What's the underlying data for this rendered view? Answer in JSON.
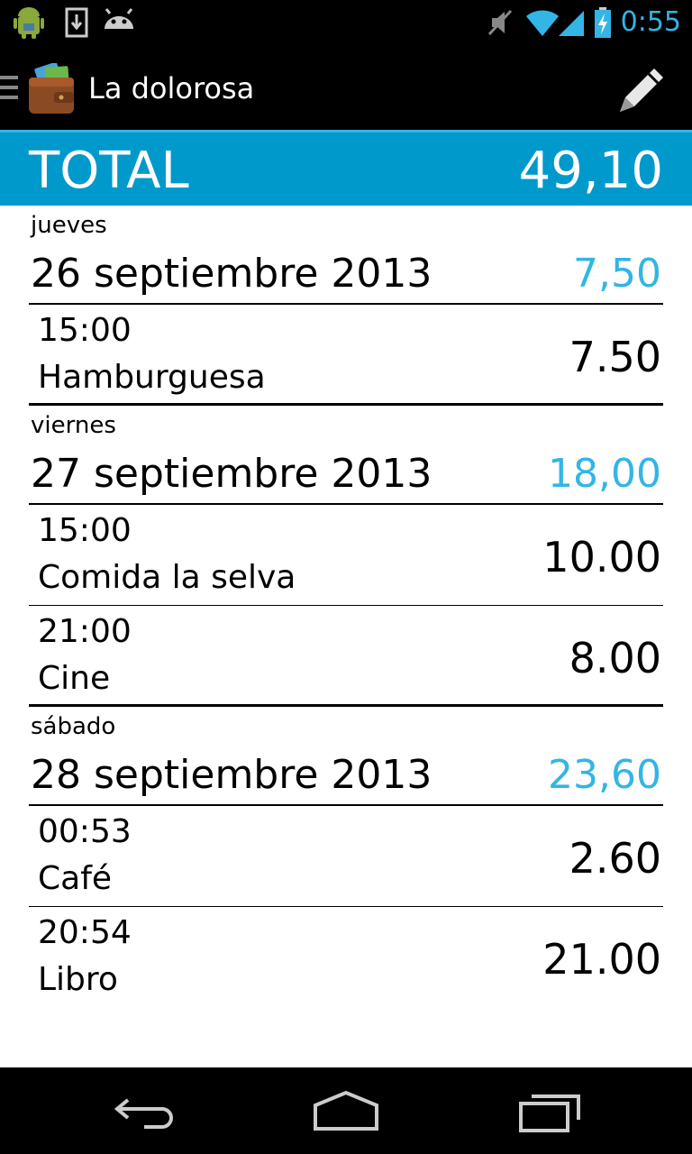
{
  "status_bar": {
    "time": "0:55",
    "icons": [
      "android-debug-icon",
      "download-icon",
      "android-icon",
      "mute-icon",
      "wifi-icon",
      "signal-icon",
      "battery-charging-icon"
    ]
  },
  "action_bar": {
    "title": "La dolorosa",
    "app_icon": "wallet-icon",
    "action_icon": "pencil-icon"
  },
  "total": {
    "label": "TOTAL",
    "value": "49,10"
  },
  "days": [
    {
      "weekday": "jueves",
      "date": "26 septiembre 2013",
      "sum": "7,50",
      "entries": [
        {
          "time": "15:00",
          "description": "Hamburguesa",
          "amount": "7.50"
        }
      ]
    },
    {
      "weekday": "viernes",
      "date": "27 septiembre 2013",
      "sum": "18,00",
      "entries": [
        {
          "time": "15:00",
          "description": "Comida la selva",
          "amount": "10.00"
        },
        {
          "time": "21:00",
          "description": "Cine",
          "amount": "8.00"
        }
      ]
    },
    {
      "weekday": "sábado",
      "date": "28 septiembre 2013",
      "sum": "23,60",
      "entries": [
        {
          "time": "00:53",
          "description": "Café",
          "amount": "2.60"
        },
        {
          "time": "20:54",
          "description": "Libro",
          "amount": "21.00"
        }
      ]
    }
  ],
  "colors": {
    "accent": "#33b5e5",
    "total_bar": "#0099cc",
    "bar_background": "#000000"
  },
  "nav_bar": {
    "icons": [
      "back-icon",
      "home-icon",
      "recents-icon"
    ]
  }
}
